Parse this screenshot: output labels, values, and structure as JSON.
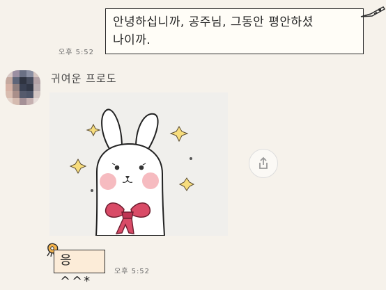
{
  "conversation": {
    "outgoing_message": {
      "lines": [
        "안녕하십니까, 공주님, 그동안 평안하셨",
        "나이까."
      ],
      "time": "오후 5:52"
    },
    "incoming": {
      "sender_name": "귀여운 프로도",
      "sticker_icon": "rabbit-with-bow-sticker",
      "reply_message": "응 ^^*",
      "time": "오후 5:52"
    },
    "actions": {
      "share_icon": "share-icon"
    },
    "colors": {
      "background": "#f6f2eb",
      "outgoing_bubble": "#fffdf7",
      "incoming_bubble": "#fcecd8",
      "bubble_border": "#2b2b2b",
      "ribbon": "#d94b67"
    }
  }
}
